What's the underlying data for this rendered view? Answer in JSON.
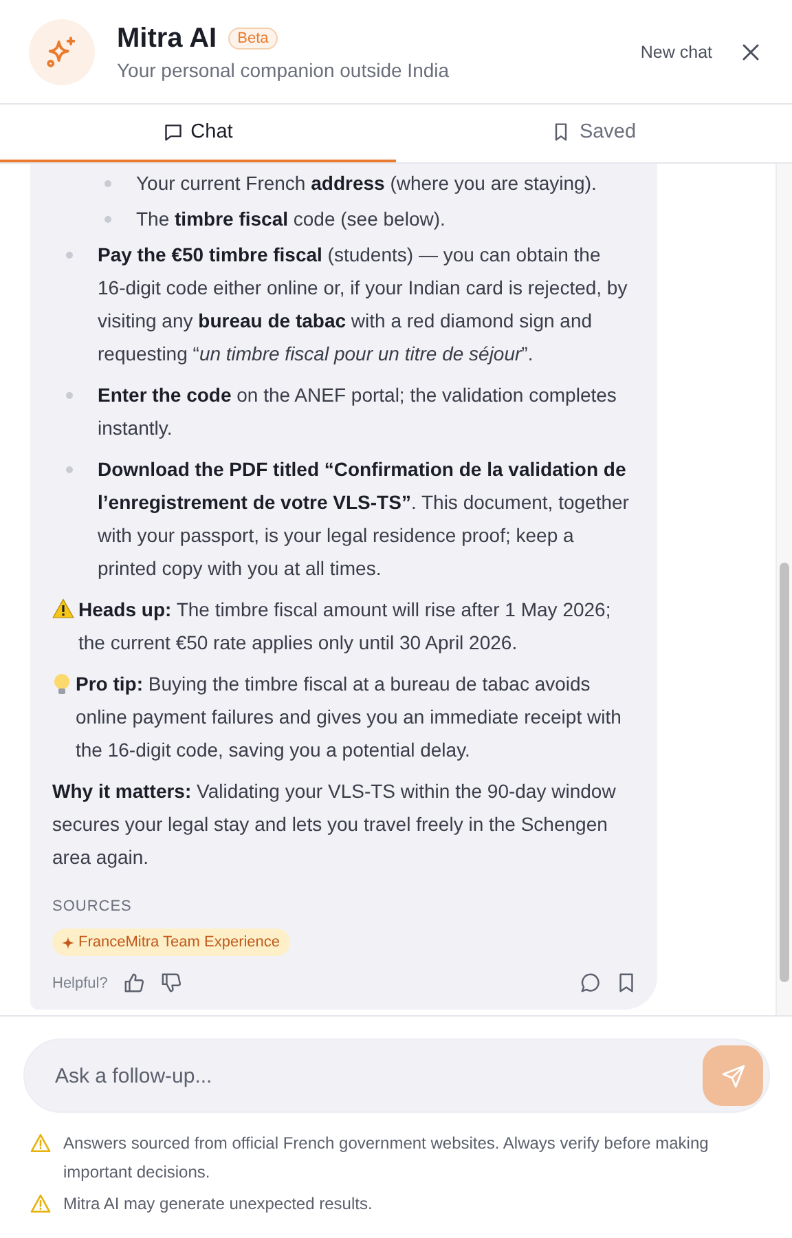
{
  "header": {
    "title": "Mitra AI",
    "badge": "Beta",
    "subtitle": "Your personal companion outside India",
    "new_chat": "New chat"
  },
  "tabs": [
    {
      "label": "Chat",
      "kind": "chat",
      "selected": true
    },
    {
      "label": "Saved",
      "kind": "saved",
      "selected": false
    }
  ],
  "message": {
    "bullets": [
      {
        "kind": "sub",
        "text": "Your current French **address** (where you are staying)."
      },
      {
        "kind": "sub",
        "text": "The **timbre fiscal** code (see below)."
      },
      {
        "kind": "main",
        "text": "**Pay the €50 timbre fiscal** (students) — you can obtain the 16‑digit code either online or, if your Indian card is rejected, by visiting any **bureau de tabac** with a red diamond sign and requesting “*un timbre fiscal pour un titre de séjour*”."
      },
      {
        "kind": "main",
        "text": "**Enter the code** on the ANEF portal; the validation completes instantly."
      },
      {
        "kind": "main",
        "text": "**Download the PDF titled “Confirmation de la validation de l’enregistrement de votre VLS‑TS”**. This document, together with your passport, is your legal residence proof; keep a printed copy with you at all times."
      }
    ],
    "paragraphs": [
      {
        "kind": "warning",
        "text": "**Heads up:** The timbre fiscal amount will rise after 1 May 2026; the current €50 rate applies only until 30 April 2026."
      },
      {
        "kind": "tip",
        "text": "**Pro tip:** Buying the timbre fiscal at a bureau de tabac avoids online payment failures and gives you an immediate receipt with the 16‑digit code, saving you a potential delay."
      },
      {
        "kind": "plain",
        "text": "**Why it matters:** Validating your VLS‑TS within the 90‑day window secures your legal stay and lets you travel freely in the Schengen area again."
      }
    ],
    "sources_label": "SOURCES",
    "sources": [
      "FranceMitra Team Experience"
    ],
    "helpful_label": "Helpful?"
  },
  "input": {
    "placeholder": "Ask a follow-up..."
  },
  "disclaimers": [
    "Answers sourced from official French government websites. Always verify before making important decisions.",
    "Mitra AI may generate unexpected results."
  ]
}
